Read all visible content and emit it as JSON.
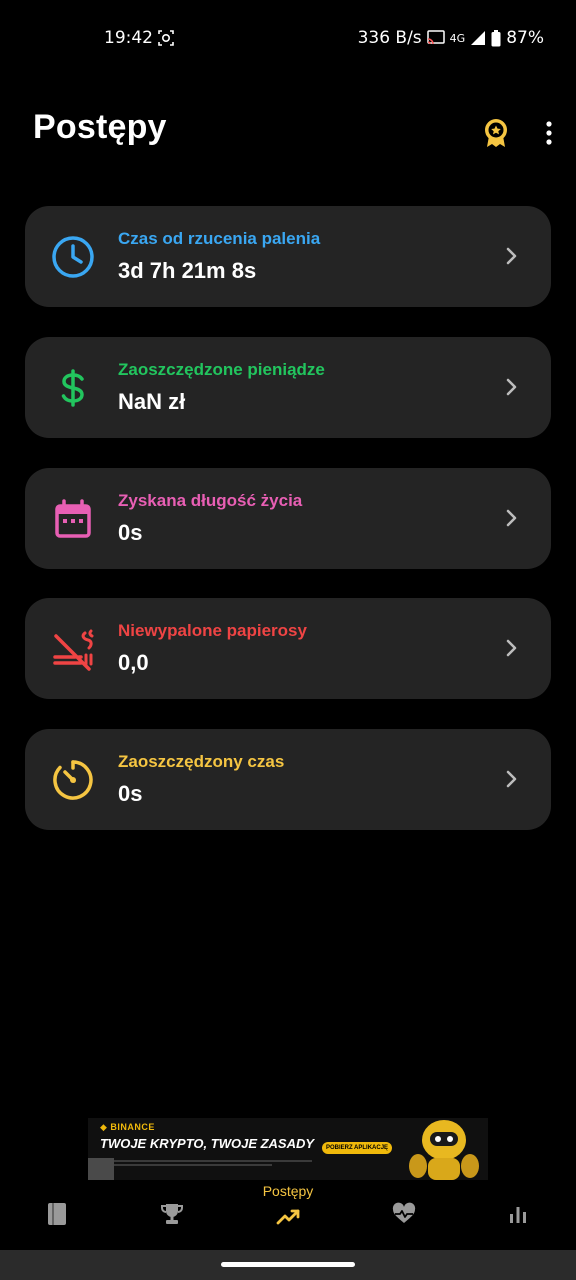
{
  "status_bar": {
    "time": "19:42",
    "net_speed": "336 B/s",
    "network": "4G",
    "battery": "87%"
  },
  "header": {
    "title": "Postępy",
    "award_icon": "award-badge-icon",
    "menu_icon": "more-vertical-icon"
  },
  "cards": [
    {
      "title": "Czas od rzucenia palenia",
      "value": "3d 7h 21m 8s",
      "color": "#3aa7f2",
      "icon": "clock-icon"
    },
    {
      "title": "Zaoszczędzone pieniądze",
      "value": "NaN zł",
      "color": "#22c55e",
      "icon": "dollar-icon"
    },
    {
      "title": "Zyskana długość życia",
      "value": "0s",
      "color": "#e85fb4",
      "icon": "calendar-icon"
    },
    {
      "title": "Niewypalone papierosy",
      "value": "0,0",
      "color": "#ef4444",
      "icon": "no-smoking-icon"
    },
    {
      "title": "Zaoszczędzony czas",
      "value": "0s",
      "color": "#f5c542",
      "icon": "timer-icon"
    }
  ],
  "ad": {
    "brand": "BINANCE",
    "headline": "TWOJE KRYPTO, TWOJE ZASADY",
    "cta": "POBIERZ APLIKACJĘ"
  },
  "bottom_nav": {
    "active_label": "Postępy",
    "accent": "#f5c542",
    "items": [
      "journal-icon",
      "trophy-icon",
      "progress-icon",
      "health-icon",
      "stats-icon"
    ]
  }
}
